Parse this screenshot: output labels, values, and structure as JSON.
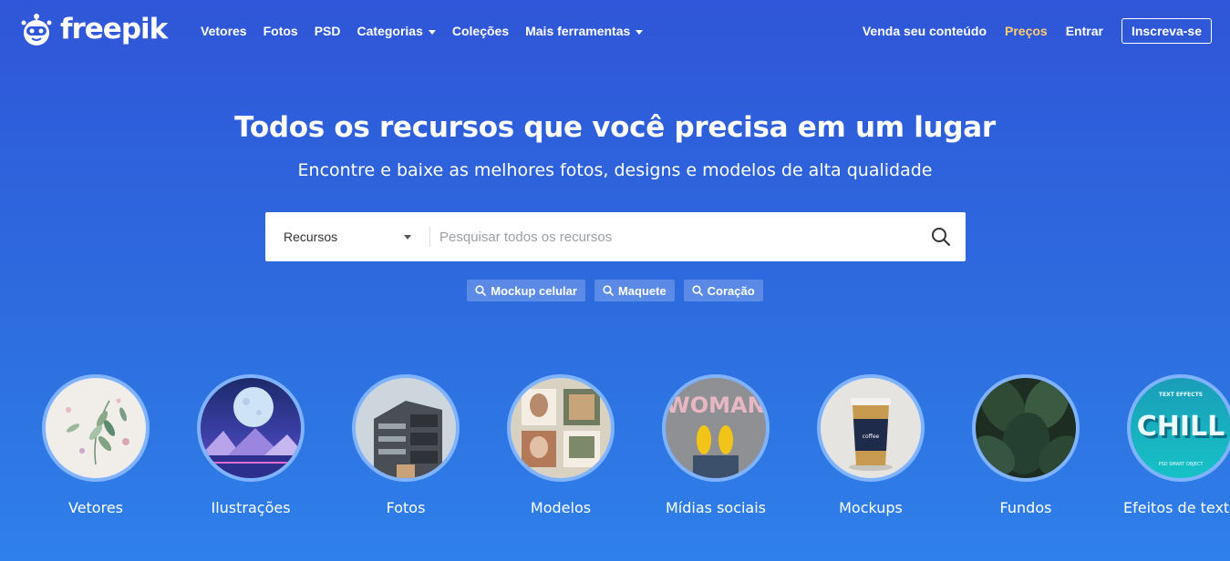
{
  "brand": {
    "name": "freepik"
  },
  "nav": {
    "links": [
      {
        "label": "Vetores",
        "dropdown": false
      },
      {
        "label": "Fotos",
        "dropdown": false
      },
      {
        "label": "PSD",
        "dropdown": false
      },
      {
        "label": "Categorias",
        "dropdown": true
      },
      {
        "label": "Coleções",
        "dropdown": false
      },
      {
        "label": "Mais ferramentas",
        "dropdown": true
      }
    ],
    "sell": "Venda seu conteúdo",
    "pricing": "Preços",
    "login": "Entrar",
    "signup": "Inscreva-se"
  },
  "hero": {
    "title": "Todos os recursos que você precisa em um lugar",
    "subtitle": "Encontre e baixe as melhores fotos, designs e modelos de alta qualidade"
  },
  "search": {
    "type_selected": "Recursos",
    "placeholder": "Pesquisar todos os recursos"
  },
  "tags": [
    "Mockup celular",
    "Maquete",
    "Coração"
  ],
  "categories": [
    {
      "label": "Vetores",
      "icon": "leaves-illustration"
    },
    {
      "label": "Ilustrações",
      "icon": "moon-mountains-illustration"
    },
    {
      "label": "Fotos",
      "icon": "building-photo"
    },
    {
      "label": "Modelos",
      "icon": "social-templates-thumbnail"
    },
    {
      "label": "Mídias sociais",
      "icon": "woman-yellow-shoes-photo"
    },
    {
      "label": "Mockups",
      "icon": "coffee-cup-mockup"
    },
    {
      "label": "Fundos",
      "icon": "tropical-leaves-background"
    },
    {
      "label": "Efeitos de texto",
      "icon": "chill-text-effect"
    }
  ],
  "colors": {
    "background_top": "#2f56d8",
    "background_bottom": "#2f80ea",
    "pricing": "#ffcd6e",
    "circle_border": "#7fb3ff"
  }
}
